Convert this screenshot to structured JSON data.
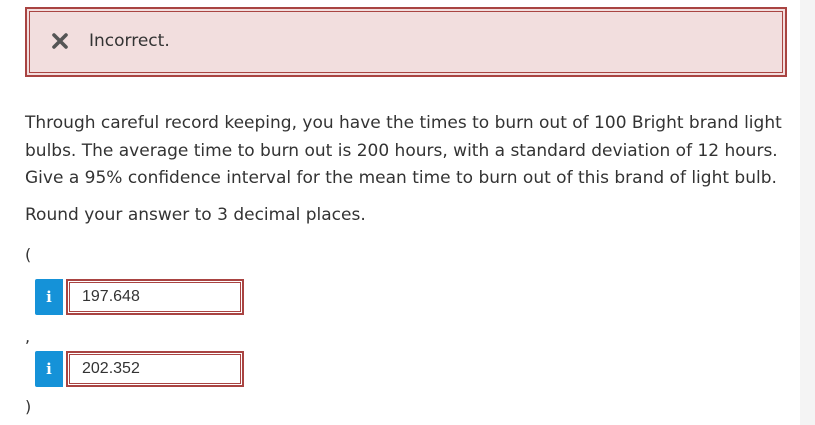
{
  "alert": {
    "status": "Incorrect.",
    "icon": "x-icon",
    "colors": {
      "background": "#f2dede",
      "border": "#a94442",
      "icon": "#555555"
    }
  },
  "question": {
    "text": "Through careful record keeping, you have the times to burn out of 100 Bright brand light bulbs. The average time to burn out is 200 hours, with a standard deviation of 12 hours. Give a 95% confidence interval for the mean time to burn out of this brand of light bulb.",
    "instruction": "Round your answer to 3 decimal places."
  },
  "interval": {
    "open_paren": "(",
    "separator": ",",
    "close_paren": ")",
    "lower": {
      "value": "197.648",
      "info_label": "i",
      "info_icon": "info-icon"
    },
    "upper": {
      "value": "202.352",
      "info_label": "i",
      "info_icon": "info-icon"
    }
  },
  "colors": {
    "info_button": "#1592d8",
    "incorrect_border": "#a94442",
    "text": "#333333"
  }
}
